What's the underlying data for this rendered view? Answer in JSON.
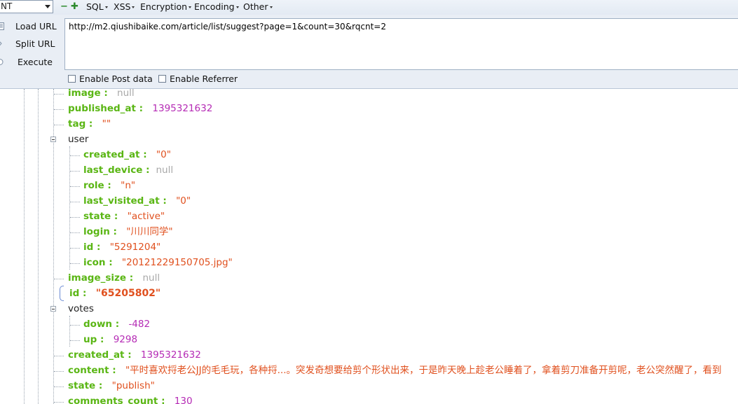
{
  "toolbar": {
    "combo_value": "NT",
    "menus": [
      "SQL",
      "XSS",
      "Encryption",
      "Encoding",
      "Other"
    ],
    "buttons": {
      "load": "Load URL",
      "split": "Split URL",
      "execute": "Execute"
    },
    "url": "http://m2.qiushibaike.com/article/list/suggest?page=1&count=30&rqcnt=2",
    "enable_post": "Enable Post data",
    "enable_referrer": "Enable Referrer"
  },
  "tree": {
    "image": {
      "key": "image",
      "value": "null"
    },
    "published_at": {
      "key": "published_at",
      "value": "1395321632"
    },
    "tag": {
      "key": "tag",
      "value": "\"\""
    },
    "user": {
      "key": "user",
      "created_at": {
        "key": "created_at",
        "value": "\"0\""
      },
      "last_device": {
        "key": "last_device",
        "value": "null"
      },
      "role": {
        "key": "role",
        "value": "\"n\""
      },
      "last_visited_at": {
        "key": "last_visited_at",
        "value": "\"0\""
      },
      "state": {
        "key": "state",
        "value": "\"active\""
      },
      "login": {
        "key": "login",
        "value": "\"川川同学\""
      },
      "id": {
        "key": "id",
        "value": "\"5291204\""
      },
      "icon": {
        "key": "icon",
        "value": "\"20121229150705.jpg\""
      }
    },
    "image_size": {
      "key": "image_size",
      "value": "null"
    },
    "id": {
      "key": "id",
      "value": "\"65205802\""
    },
    "votes": {
      "key": "votes",
      "down": {
        "key": "down",
        "value": "-482"
      },
      "up": {
        "key": "up",
        "value": "9298"
      }
    },
    "created_at": {
      "key": "created_at",
      "value": "1395321632"
    },
    "content": {
      "key": "content",
      "value": "\"平时喜欢捋老公JJ的毛毛玩，各种捋...。突发奇想要给剪个形状出来，于是昨天晚上趁老公睡着了，拿着剪刀准备开剪呢，老公突然醒了，看到"
    },
    "state": {
      "key": "state",
      "value": "\"publish\""
    },
    "comments_count": {
      "key": "comments_count",
      "value": "130"
    }
  }
}
